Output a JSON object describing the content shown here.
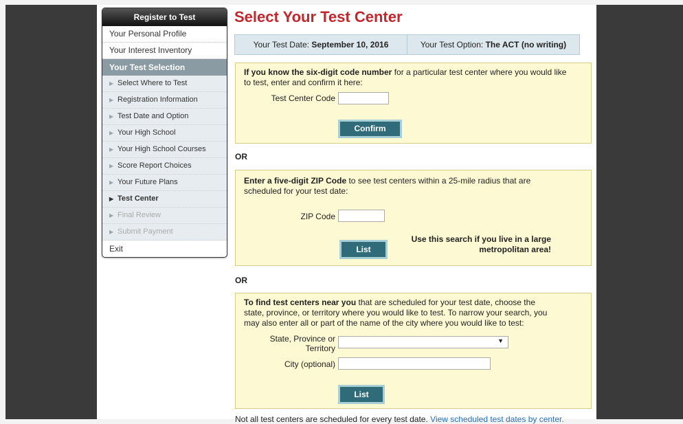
{
  "sidebar": {
    "header": "Register to Test",
    "top_items": [
      "Your Personal Profile",
      "Your Interest Inventory"
    ],
    "section": "Your Test Selection",
    "sub_items": [
      {
        "label": "Select Where to Test",
        "state": "normal"
      },
      {
        "label": "Registration Information",
        "state": "normal"
      },
      {
        "label": "Test Date and Option",
        "state": "normal"
      },
      {
        "label": "Your High School",
        "state": "normal"
      },
      {
        "label": "Your High School Courses",
        "state": "normal"
      },
      {
        "label": "Score Report Choices",
        "state": "normal"
      },
      {
        "label": "Your Future Plans",
        "state": "normal"
      },
      {
        "label": "Test Center",
        "state": "active"
      },
      {
        "label": "Final Review",
        "state": "disabled"
      },
      {
        "label": "Submit Payment",
        "state": "disabled"
      }
    ],
    "exit": "Exit"
  },
  "main": {
    "title": "Select Your Test Center",
    "info": {
      "date_label": "Your Test Date:",
      "date_value": "September 10, 2016",
      "option_label": "Your Test Option:",
      "option_value": "The ACT (no writing)"
    },
    "code_box": {
      "intro_bold": "If you know the six-digit code number",
      "intro_rest": " for a particular test center where you would like to test, enter and confirm it here:",
      "field_label": "Test Center Code",
      "field_value": "",
      "button": "Confirm"
    },
    "or1": "OR",
    "zip_box": {
      "intro_bold": "Enter a five-digit ZIP Code",
      "intro_rest": " to see test centers within a 25-mile radius that are scheduled for your test date:",
      "field_label": "ZIP Code",
      "field_value": "",
      "button": "List",
      "hint_line1": "Use this search if you live in a large",
      "hint_line2": "metropolitan area!"
    },
    "or2": "OR",
    "state_box": {
      "intro_bold": "To find test centers near you",
      "intro_rest": " that are scheduled for your test date, choose the state, province, or territory where you would like to test. To narrow your search, you may also enter all or part of the name of the city where you would like to test:",
      "state_label_1": "State, Province or",
      "state_label_2": "Territory",
      "state_value": "",
      "city_label": "City (optional)",
      "city_value": "",
      "button": "List"
    },
    "footer_text": "Not all test centers are scheduled for every test date. ",
    "footer_link": "View scheduled test dates by center."
  }
}
